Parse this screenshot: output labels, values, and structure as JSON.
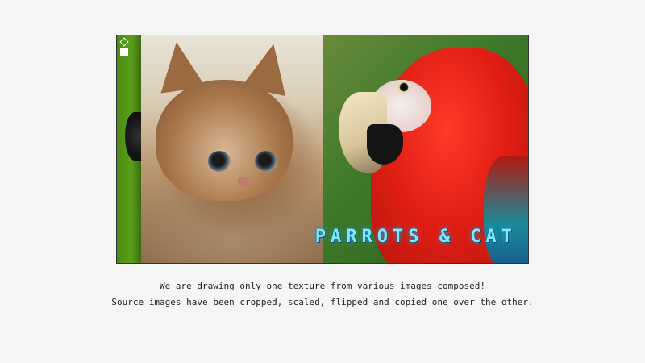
{
  "canvas": {
    "title": "PARROTS & CAT",
    "images": [
      {
        "name": "kitten photo"
      },
      {
        "name": "scarlet macaw photo"
      }
    ]
  },
  "controls": {
    "icons": [
      "diamond-outline-icon",
      "square-icon"
    ]
  },
  "captions": {
    "line1": "We are drawing only one texture from various images composed!",
    "line2": "Source images have been cropped, scaled, flipped and copied one over the other."
  },
  "colors": {
    "background": "#f5f5f5",
    "title_text": "#7fe8ff",
    "title_glow": "#2ab0e0"
  }
}
